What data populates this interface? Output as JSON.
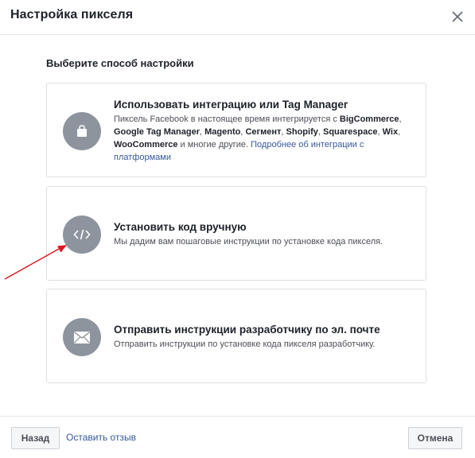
{
  "header": {
    "title": "Настройка пикселя",
    "close_icon": "close-icon"
  },
  "subtitle": "Выберите способ настройки",
  "options": [
    {
      "icon": "shopping-bag-icon",
      "title": "Использовать интеграцию или Tag Manager",
      "desc": {
        "intro": "Пиксель Facebook в настоящее время интегрируется с",
        "partners": [
          "BigCommerce",
          "Google Tag Manager",
          "Magento",
          "Сегмент",
          "Shopify",
          "Squarespace",
          "Wix",
          "WooCommerce"
        ],
        "tail": "и многие другие.",
        "link": "Подробнее об интеграции с платформами"
      }
    },
    {
      "icon": "code-icon",
      "title": "Установить код вручную",
      "desc": "Мы дадим вам пошаговые инструкции по установке кода пикселя."
    },
    {
      "icon": "envelope-icon",
      "title": "Отправить инструкции разработчику по эл. почте",
      "desc": "Отправить инструкции по установке кода пикселя разработчику."
    }
  ],
  "footer": {
    "back_label": "Назад",
    "feedback_label": "Оставить отзыв",
    "cancel_label": "Отмена"
  },
  "colors": {
    "icon_circle": "#8d949e",
    "link": "#365899",
    "arrow": "#e0161c"
  }
}
